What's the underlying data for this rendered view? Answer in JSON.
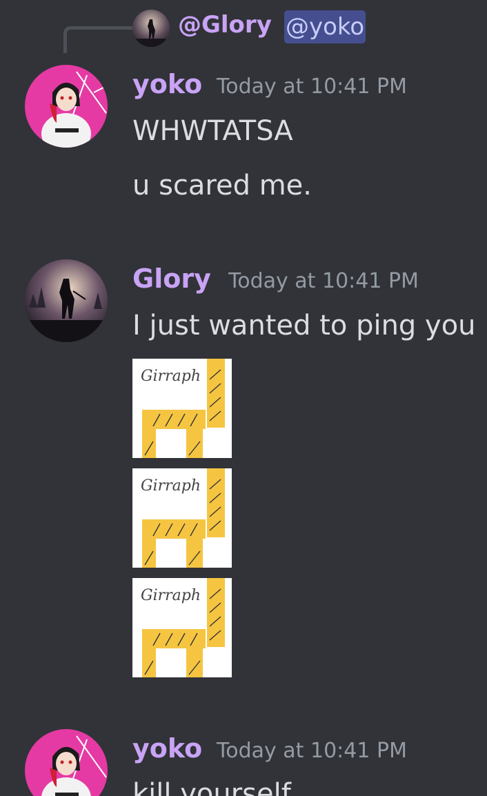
{
  "reply": {
    "author": "@Glory",
    "mention": "@yoko"
  },
  "messages": [
    {
      "author": "yoko",
      "timestamp": "Today at 10:41 PM",
      "lines": [
        "WHWTATSA",
        "u scared me."
      ]
    },
    {
      "author": "Glory",
      "timestamp": "Today at 10:41 PM",
      "lines": [
        "I just wanted to ping you"
      ],
      "attachments": [
        {
          "caption": "Girraph"
        },
        {
          "caption": "Girraph"
        },
        {
          "caption": "Girraph"
        }
      ]
    },
    {
      "author": "yoko",
      "timestamp": "Today at 10:41 PM",
      "lines": [
        "kill yourself"
      ]
    }
  ],
  "colors": {
    "background": "#313338",
    "username": "#c9a3f5",
    "timestamp": "#949ba4",
    "text": "#dbdee1",
    "mention_bg": "#454f8f",
    "giraffe_yellow": "#f5c542",
    "yoko_avatar_bg": "#e53aa4"
  }
}
